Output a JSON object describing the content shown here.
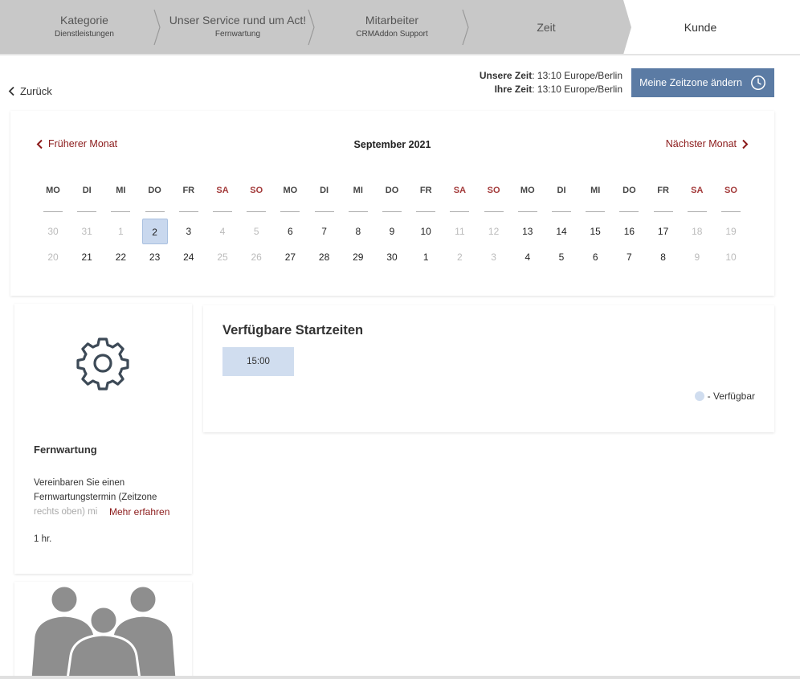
{
  "steps": [
    {
      "title": "Kategorie",
      "sub": "Dienstleistungen"
    },
    {
      "title": "Unser Service rund um Act!",
      "sub": "Fernwartung"
    },
    {
      "title": "Mitarbeiter",
      "sub": "CRMAddon Support"
    },
    {
      "title": "Zeit",
      "sub": ""
    },
    {
      "title": "Kunde",
      "sub": ""
    }
  ],
  "back_label": "Zurück",
  "time_info": {
    "our_label": "Unsere Zeit",
    "our_value": ": 13:10 Europe/Berlin",
    "your_label": "Ihre Zeit",
    "your_value": ": 13:10 Europe/Berlin"
  },
  "tz_button_label": "Meine Zeitzone ändern",
  "calendar": {
    "prev_label": "Früherer Monat",
    "next_label": "Nächster Monat",
    "month_label": "September 2021",
    "weekdays": [
      "MO",
      "DI",
      "MI",
      "DO",
      "FR",
      "SA",
      "SO",
      "MO",
      "DI",
      "MI",
      "DO",
      "FR",
      "SA",
      "SO",
      "MO",
      "DI",
      "MI",
      "DO",
      "FR",
      "SA",
      "SO"
    ],
    "rows": [
      [
        "30",
        "31",
        "1",
        "2",
        "3",
        "4",
        "5",
        "6",
        "7",
        "8",
        "9",
        "10",
        "11",
        "12",
        "13",
        "14",
        "15",
        "16",
        "17",
        "18",
        "19"
      ],
      [
        "20",
        "21",
        "22",
        "23",
        "24",
        "25",
        "26",
        "27",
        "28",
        "29",
        "30",
        "1",
        "2",
        "3",
        "4",
        "5",
        "6",
        "7",
        "8",
        "9",
        "10"
      ]
    ],
    "selected": "2"
  },
  "service": {
    "title": "Fernwartung",
    "desc_line1": "Vereinbaren Sie einen",
    "desc_line2": "Fernwartungstermin (Zeitzone",
    "desc_line3": "rechts oben) mi",
    "more_label": "Mehr erfahren",
    "duration": "1 hr."
  },
  "times": {
    "title": "Verfügbare Startzeiten",
    "slots": [
      "15:00"
    ],
    "legend": "- Verfügbar"
  },
  "colors": {
    "accent": "#5b7ba4",
    "link": "#8b1a1a",
    "weekend": "#a33a3a",
    "slot": "#d0ddef",
    "steps_bg": "#c8c8c8"
  }
}
